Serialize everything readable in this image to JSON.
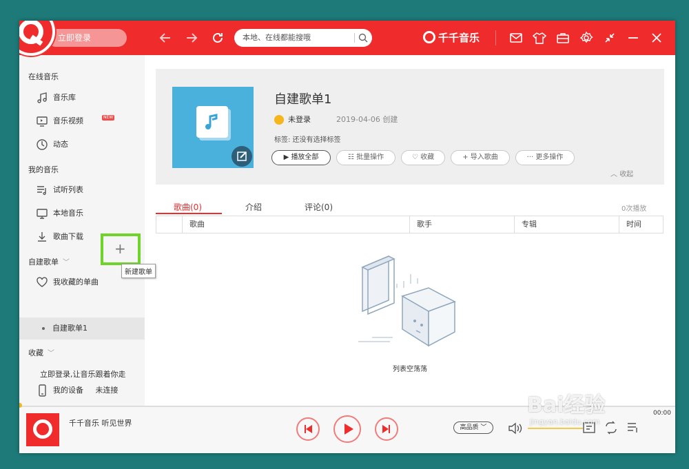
{
  "topbar": {
    "login_label": "立即登录",
    "search_placeholder": "本地、在线都能搜哦",
    "brand_name": "千千音乐",
    "accent_color": "#ef2b2c"
  },
  "sidebar": {
    "online_title": "在线音乐",
    "online_items": [
      {
        "label": "音乐库",
        "icon": "music-note-icon"
      },
      {
        "label": "音乐视频",
        "icon": "monitor-play-icon",
        "badge": "NEW"
      },
      {
        "label": "动态",
        "icon": "clock-icon"
      }
    ],
    "my_title": "我的音乐",
    "my_items": [
      {
        "label": "试听列表",
        "icon": "playlist-icon"
      },
      {
        "label": "本地音乐",
        "icon": "monitor-icon"
      },
      {
        "label": "歌曲下载",
        "icon": "download-icon"
      }
    ],
    "custom_title": "自建歌单",
    "new_playlist_tooltip": "新建歌单",
    "fav_single": "我收藏的单曲",
    "active_playlist": "自建歌单1",
    "collect_title": "收藏",
    "login_hint": "立即登录,让音乐跟着你走",
    "device_label": "我的设备",
    "device_status": "未连接"
  },
  "playlist": {
    "title": "自建歌单1",
    "user": "未登录",
    "date": "2019-04-06 创建",
    "tags": "标签: 还没有选择标签",
    "buttons": {
      "play_all": "播放全部",
      "batch": "批量操作",
      "collect": "收藏",
      "import": "导入歌曲",
      "more": "更多操作"
    },
    "collapse": "收起"
  },
  "tabs": {
    "songs": "歌曲(0)",
    "intro": "介绍",
    "comments": "评论(0)",
    "play_count": "0次播放"
  },
  "table": {
    "columns": [
      "歌曲",
      "歌手",
      "专辑",
      "时间"
    ]
  },
  "empty": {
    "text": "列表空荡荡"
  },
  "player": {
    "now_playing": "千千音乐 听见世界",
    "quality": "高品质",
    "time": "00:00",
    "progress": 0
  },
  "watermark": {
    "text": "Bai经验",
    "url": "jingyan.baidu.com"
  }
}
